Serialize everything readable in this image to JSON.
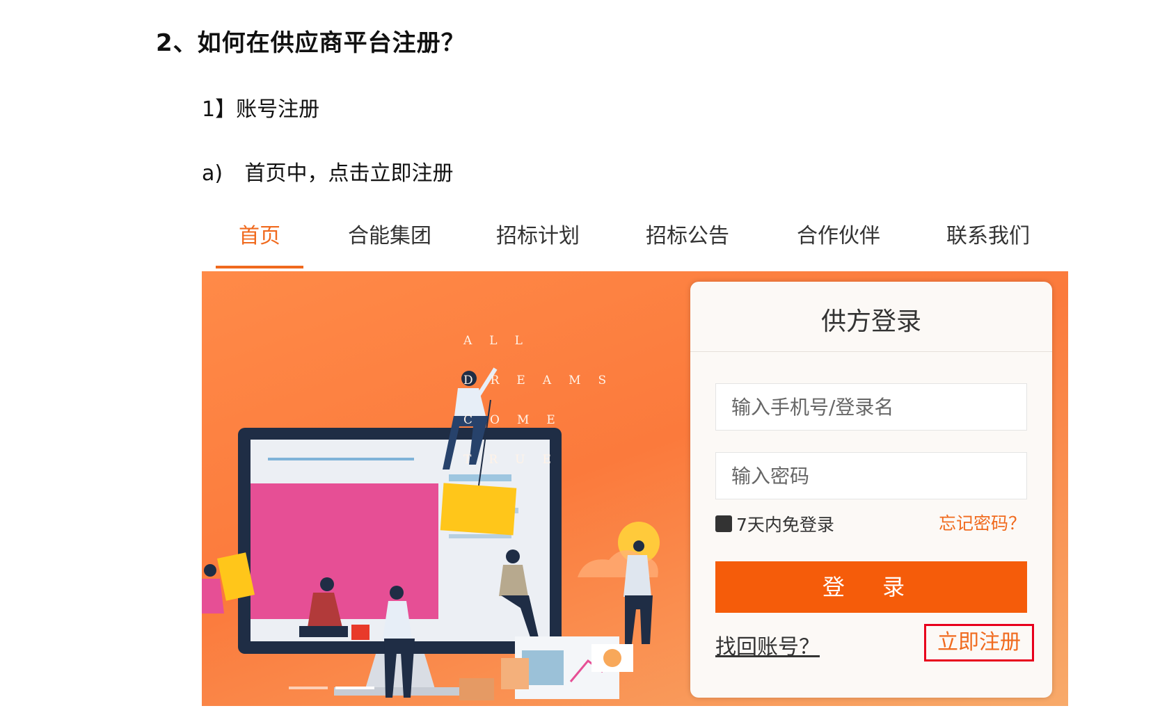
{
  "heading": "2、如何在供应商平台注册？",
  "subheading": "1】账号注册",
  "step": {
    "label": "a)",
    "text": "首页中，点击立即注册"
  },
  "nav": {
    "tabs": [
      "首页",
      "合能集团",
      "招标计划",
      "招标公告",
      "合作伙伴",
      "联系我们"
    ],
    "active_index": 0
  },
  "banner": {
    "slogan": [
      "ALL",
      "DREAMS",
      "COME",
      "TRUE"
    ],
    "slide_count": 2,
    "active_slide": 2
  },
  "login": {
    "title": "供方登录",
    "username_placeholder": "输入手机号/登录名",
    "password_placeholder": "输入密码",
    "remember_label": "7天内免登录",
    "forgot_link": "忘记密码？",
    "login_button": "登 录",
    "retrieve_link": "找回账号？",
    "register_link": "立即注册"
  },
  "colors": {
    "accent": "#f06a1e",
    "button": "#f55c0a",
    "highlight_box": "#e8001c",
    "banner_bg": "#fb7a3c"
  }
}
